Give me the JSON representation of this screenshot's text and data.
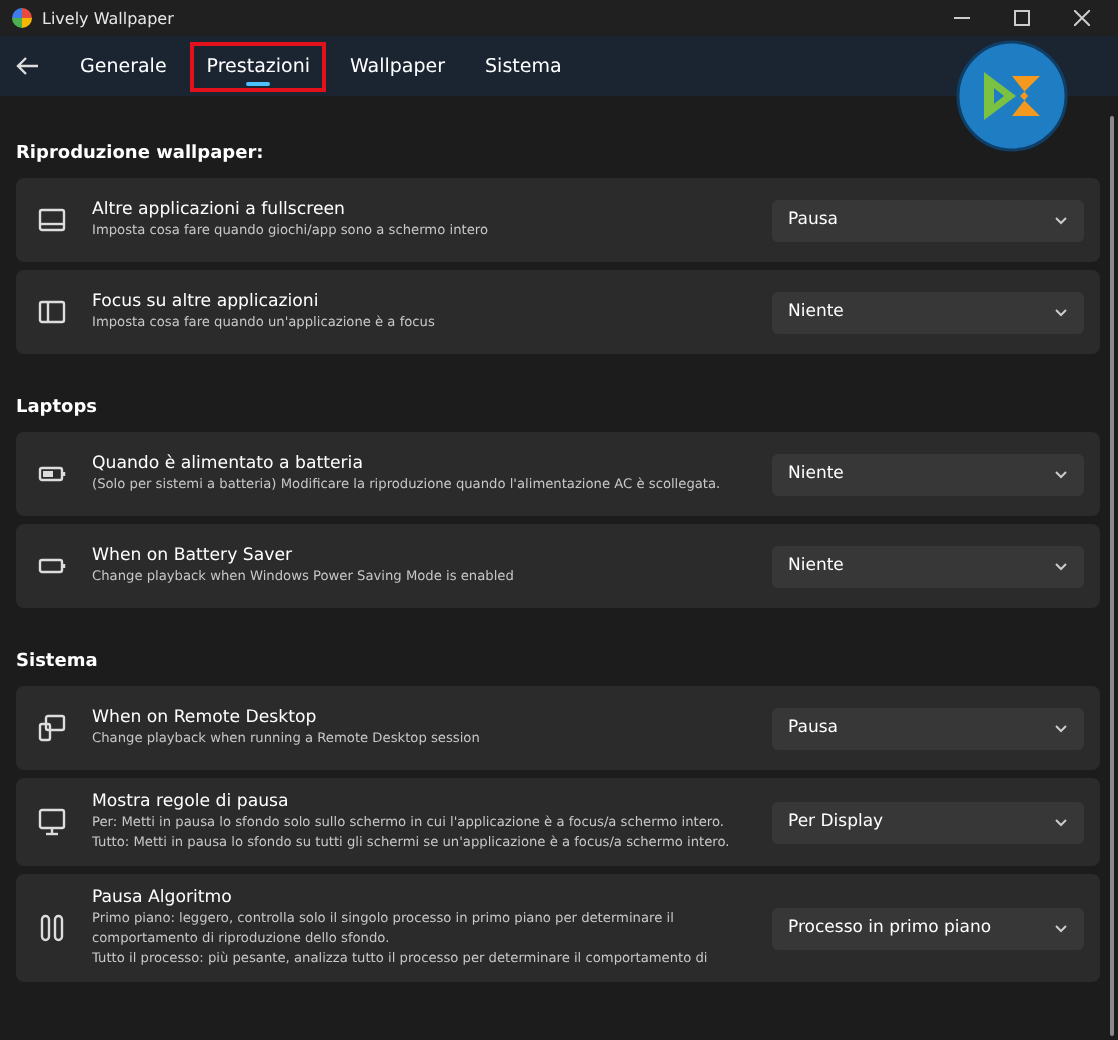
{
  "window": {
    "title": "Lively Wallpaper"
  },
  "tabs": [
    {
      "label": "Generale",
      "selected": false
    },
    {
      "label": "Prestazioni",
      "selected": true
    },
    {
      "label": "Wallpaper",
      "selected": false
    },
    {
      "label": "Sistema",
      "selected": false
    }
  ],
  "sections": [
    {
      "title": "Riproduzione wallpaper:",
      "settings": [
        {
          "kind": "fullscreen",
          "title": "Altre applicazioni a fullscreen",
          "description": [
            "Imposta cosa fare quando giochi/app sono a schermo intero"
          ],
          "value": "Pausa"
        },
        {
          "kind": "sidebar",
          "title": "Focus su altre applicazioni",
          "description": [
            "Imposta cosa fare quando un'applicazione è a focus"
          ],
          "value": "Niente"
        }
      ]
    },
    {
      "title": "Laptops",
      "settings": [
        {
          "kind": "battery",
          "title": "Quando è alimentato a batteria",
          "description": [
            "(Solo per sistemi a batteria) Modificare la riproduzione quando l'alimentazione AC è scollegata."
          ],
          "value": "Niente"
        },
        {
          "kind": "saver",
          "title": "When on Battery Saver",
          "description": [
            "Change playback when Windows Power Saving Mode is enabled"
          ],
          "value": "Niente"
        }
      ]
    },
    {
      "title": "Sistema",
      "settings": [
        {
          "kind": "remote",
          "title": "When on Remote Desktop",
          "description": [
            "Change playback when running a Remote Desktop session"
          ],
          "value": "Pausa"
        },
        {
          "kind": "monitor",
          "title": "Mostra regole di pausa",
          "description": [
            "Per: Metti in pausa lo sfondo solo sullo schermo in cui l'applicazione è a focus/a schermo intero.",
            "Tutto: Metti in pausa lo sfondo su tutti gli schermi se un'applicazione è a focus/a schermo intero."
          ],
          "value": "Per Display"
        },
        {
          "kind": "pause",
          "title": "Pausa Algoritmo",
          "description": [
            "Primo piano: leggero, controlla solo il singolo processo in primo piano per determinare il comportamento di riproduzione dello sfondo.",
            "Tutto il processo: più pesante, analizza tutto il processo per determinare il comportamento di"
          ],
          "value": "Processo in primo piano"
        }
      ]
    }
  ]
}
